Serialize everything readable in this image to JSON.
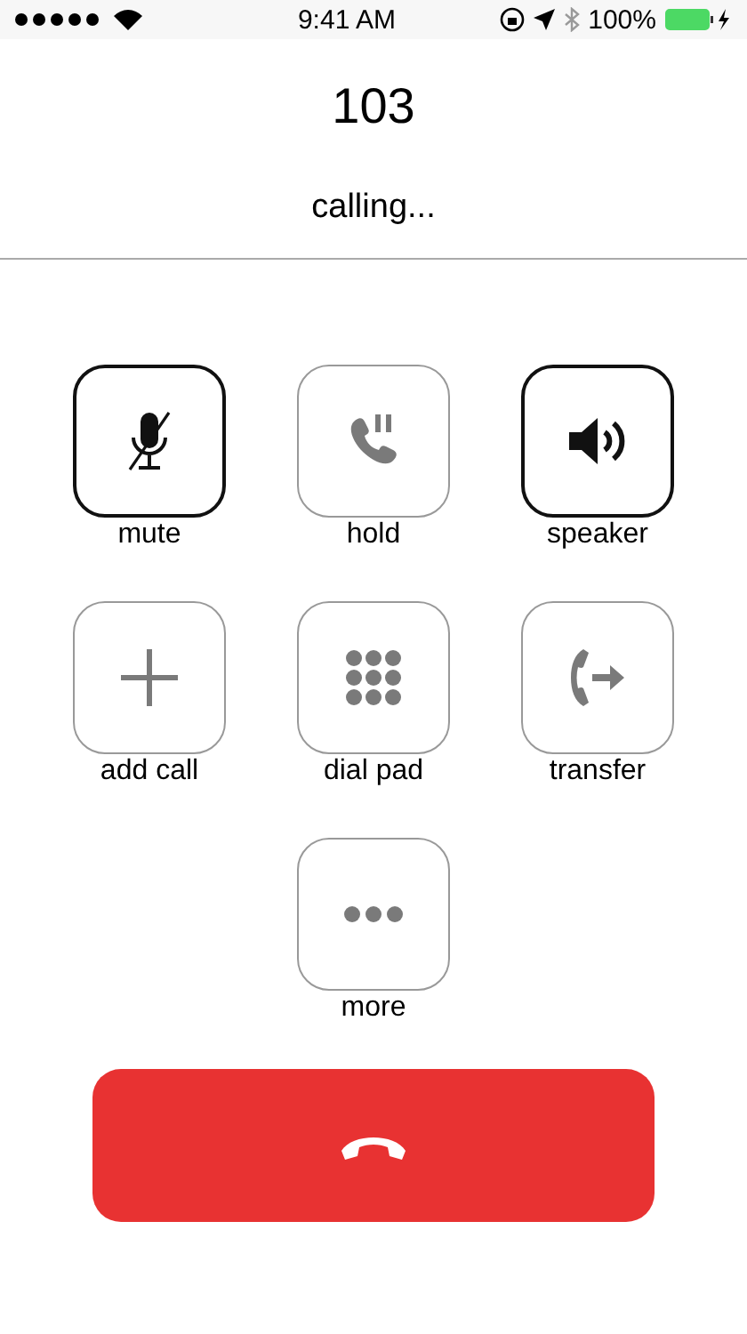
{
  "status_bar": {
    "time": "9:41 AM",
    "battery": "100%"
  },
  "call": {
    "number": "103",
    "status": "calling..."
  },
  "controls": [
    {
      "kind": "mute",
      "label": "mute",
      "on": true
    },
    {
      "kind": "hold",
      "label": "hold",
      "on": false
    },
    {
      "kind": "speaker",
      "label": "speaker",
      "on": true
    },
    {
      "kind": "add",
      "label": "add call",
      "on": false
    },
    {
      "kind": "dialpad",
      "label": "dial pad",
      "on": false
    },
    {
      "kind": "transfer",
      "label": "transfer",
      "on": false
    },
    {
      "kind": "more",
      "label": "more",
      "on": false
    }
  ]
}
